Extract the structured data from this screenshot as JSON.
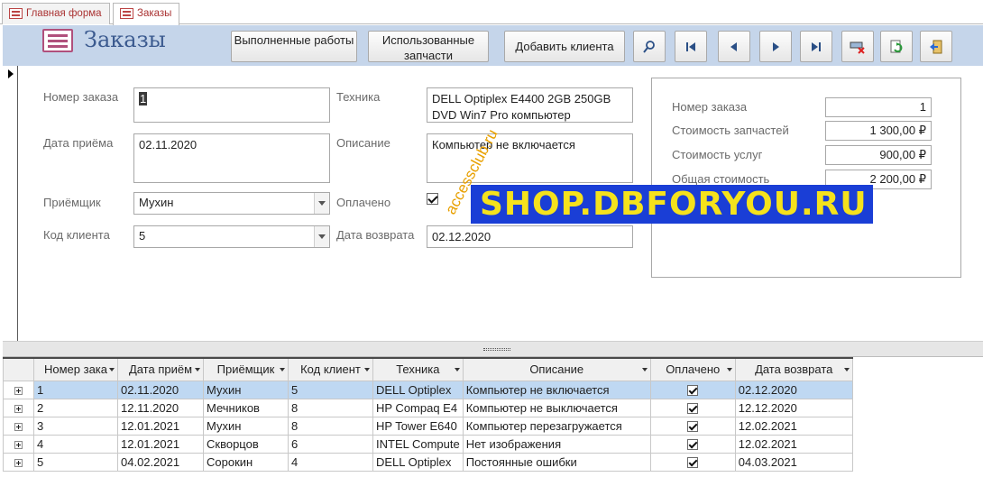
{
  "tabs": [
    {
      "label": "Главная форма",
      "active": false
    },
    {
      "label": "Заказы",
      "active": true
    }
  ],
  "header": {
    "title": "Заказы",
    "buttons": {
      "done_works": "Выполненные работы",
      "used_parts": "Использованные запчасти",
      "add_client": "Добавить клиента"
    },
    "icon_buttons": [
      "search-icon",
      "first-record-icon",
      "previous-record-icon",
      "next-record-icon",
      "last-record-icon",
      "delete-record-icon",
      "refresh-icon",
      "close-form-icon"
    ]
  },
  "form": {
    "order_no_label": "Номер заказа",
    "order_no_value": "1",
    "date_label": "Дата приёма",
    "date_value": "02.11.2020",
    "receiver_label": "Приёмщик",
    "receiver_value": "Мухин",
    "client_label": "Код клиента",
    "client_value": "5",
    "tech_label": "Техника",
    "tech_value": "DELL Optiplex E4400 2GB 250GB DVD Win7 Pro компьютер",
    "desc_label": "Описание",
    "desc_value": "Компьютер не включается",
    "paid_label": "Оплачено",
    "paid_value": true,
    "return_label": "Дата возврата",
    "return_value": "02.12.2020"
  },
  "summary": {
    "order_no_label": "Номер заказа",
    "order_no_value": "1",
    "parts_cost_label": "Стоимость запчастей",
    "parts_cost_value": "1 300,00 ₽",
    "service_cost_label": "Стоимость услуг",
    "service_cost_value": "900,00 ₽",
    "total_label": "Общая стоимость",
    "total_value": "2 200,00 ₽"
  },
  "watermark": {
    "main": "SHOP.DBFORYOU.RU",
    "diagonal": "accessclub.ru"
  },
  "table": {
    "columns": [
      "Номер зака",
      "Дата приём",
      "Приёмщик",
      "Код клиент",
      "Техника",
      "Описание",
      "Оплачено",
      "Дата возврата"
    ],
    "rows": [
      {
        "n": "1",
        "date": "02.11.2020",
        "recv": "Мухин",
        "client": "5",
        "tech": "DELL Optiplex",
        "desc": "Компьютер не включается",
        "paid": true,
        "ret": "02.12.2020"
      },
      {
        "n": "2",
        "date": "12.11.2020",
        "recv": "Мечников",
        "client": "8",
        "tech": "HP Compaq E4",
        "desc": "Компьютер не выключается",
        "paid": true,
        "ret": "12.12.2020"
      },
      {
        "n": "3",
        "date": "12.01.2021",
        "recv": "Мухин",
        "client": "8",
        "tech": "HP Tower E640",
        "desc": "Компьютер перезагружается",
        "paid": true,
        "ret": "12.02.2021"
      },
      {
        "n": "4",
        "date": "12.01.2021",
        "recv": "Скворцов",
        "client": "6",
        "tech": "INTEL Compute",
        "desc": "Нет изображения",
        "paid": true,
        "ret": "12.02.2021"
      },
      {
        "n": "5",
        "date": "04.02.2021",
        "recv": "Сорокин",
        "client": "4",
        "tech": "DELL Optiplex",
        "desc": "Постоянные ошибки",
        "paid": true,
        "ret": "04.03.2021"
      }
    ]
  }
}
